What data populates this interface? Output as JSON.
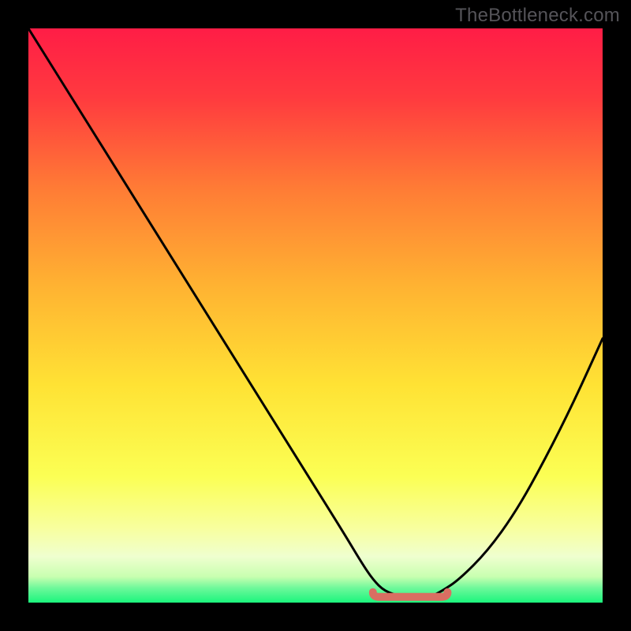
{
  "watermark": "TheBottleneck.com",
  "colors": {
    "top": "#ff1d46",
    "mid_upper": "#ff8f32",
    "mid": "#ffe234",
    "mid_lower": "#fcff6a",
    "pale": "#f3ffb8",
    "green": "#1bf57d",
    "curve": "#000000",
    "flat_marker": "#d96e62"
  },
  "chart_data": {
    "type": "line",
    "title": "",
    "xlabel": "",
    "ylabel": "",
    "xlim": [
      0,
      100
    ],
    "ylim": [
      0,
      100
    ],
    "x": [
      0,
      5,
      10,
      15,
      20,
      25,
      30,
      35,
      40,
      45,
      50,
      55,
      58,
      60,
      62,
      65,
      68,
      70,
      72,
      75,
      80,
      85,
      90,
      95,
      100
    ],
    "values": [
      100,
      92,
      84,
      76,
      68,
      60,
      52,
      44,
      36,
      28,
      20,
      12,
      7,
      4,
      2,
      1,
      1,
      1,
      2,
      4,
      9,
      16,
      25,
      35,
      46
    ],
    "flat_region": {
      "x_start": 60,
      "x_end": 73,
      "y": 1
    },
    "gradient_stops": [
      {
        "offset": 0.0,
        "color": "#ff1d46"
      },
      {
        "offset": 0.12,
        "color": "#ff3a3f"
      },
      {
        "offset": 0.28,
        "color": "#ff7c35"
      },
      {
        "offset": 0.45,
        "color": "#ffb332"
      },
      {
        "offset": 0.62,
        "color": "#ffe234"
      },
      {
        "offset": 0.78,
        "color": "#fbff54"
      },
      {
        "offset": 0.87,
        "color": "#f8ff9e"
      },
      {
        "offset": 0.92,
        "color": "#efffcf"
      },
      {
        "offset": 0.955,
        "color": "#c8ffb0"
      },
      {
        "offset": 0.975,
        "color": "#6cf89a"
      },
      {
        "offset": 1.0,
        "color": "#1bf57d"
      }
    ]
  }
}
